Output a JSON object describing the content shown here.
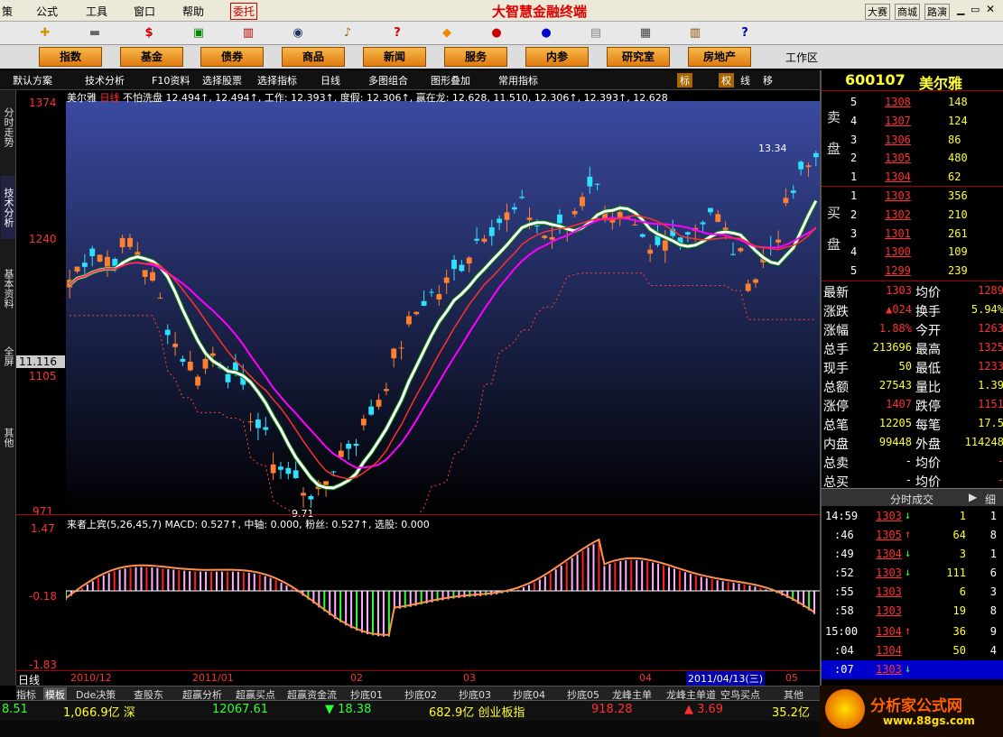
{
  "app": {
    "title": "大智慧金融终端",
    "weituo": "委托",
    "links": [
      "大赛",
      "商城",
      "路演"
    ]
  },
  "menus": [
    "策",
    "公式",
    "工具",
    "窗口",
    "帮助"
  ],
  "tabs": [
    "指数",
    "基金",
    "债券",
    "商品",
    "新闻",
    "服务",
    "内参",
    "研究室",
    "房地产"
  ],
  "workzone": "工作区",
  "subtools": [
    "默认方案",
    "技术分析",
    "F10资料",
    "选择股票",
    "选择指标",
    "日线",
    "多图组合",
    "图形叠加",
    "常用指标"
  ],
  "subtools_right": [
    "标",
    "权",
    "线",
    "移"
  ],
  "sidebar": [
    "分时走势",
    "技术分析",
    "基本资料",
    "全屏",
    "其他"
  ],
  "chart": {
    "legend_left": "美尔雅",
    "legend_period": "日线",
    "legend_text": "不怕洗盘 12.494↑, 12.494↑, 工作: 12.393↑, 度假: 12.306↑, 赢在龙: 12.628, 11.510, 12.306↑, 12.393↑, 12.628",
    "y_labels": [
      "1374",
      "1240",
      "1105",
      "971"
    ],
    "current_price": "11.116",
    "peak_label": "13.34",
    "low_label": "9.71",
    "macd_text": "来者上宾(5,26,45,7) MACD: 0.527↑, 中轴: 0.000, 粉丝: 0.527↑, 选股: 0.000",
    "macd_y": [
      "1.47",
      "-0.18",
      "-1.83"
    ],
    "x_labels": [
      "2010/12",
      "2011/01",
      "02",
      "03",
      "04",
      "2011/04/13(三)",
      "05"
    ],
    "period": "日线"
  },
  "chart_data": {
    "type": "candlestick",
    "title": "美尔雅 日线",
    "ylim": [
      9.71,
      13.74
    ],
    "peak": 13.34,
    "low": 9.71
  },
  "quote": {
    "code": "600107",
    "name": "美尔雅",
    "sell": [
      [
        "5",
        "1308",
        "148"
      ],
      [
        "4",
        "1307",
        "124"
      ],
      [
        "3",
        "1306",
        "86"
      ],
      [
        "2",
        "1305",
        "480"
      ],
      [
        "1",
        "1304",
        "62"
      ]
    ],
    "buy": [
      [
        "1",
        "1303",
        "356"
      ],
      [
        "2",
        "1302",
        "210"
      ],
      [
        "3",
        "1301",
        "261"
      ],
      [
        "4",
        "1300",
        "109"
      ],
      [
        "5",
        "1299",
        "239"
      ]
    ],
    "sell_label": "卖盘",
    "buy_label": "买盘",
    "stats": [
      [
        "最新",
        "1303",
        "均价",
        "1289"
      ],
      [
        "涨跌",
        "▲024",
        "换手",
        "5.94%"
      ],
      [
        "涨幅",
        "1.88%",
        "今开",
        "1263"
      ],
      [
        "总手",
        "213696",
        "最高",
        "1325"
      ],
      [
        "现手",
        "50",
        "最低",
        "1233"
      ],
      [
        "总额",
        "27543",
        "量比",
        "1.39"
      ],
      [
        "涨停",
        "1407",
        "跌停",
        "1151"
      ],
      [
        "总笔",
        "12205",
        "每笔",
        "17.5"
      ],
      [
        "内盘",
        "99448",
        "外盘",
        "114248"
      ],
      [
        "总卖",
        "-",
        "均价",
        "-"
      ],
      [
        "总买",
        "-",
        "均价",
        "-"
      ]
    ],
    "ticks_title": "分时成交",
    "ticks_detail": "细",
    "ticks": [
      [
        "14:59",
        "1303",
        "↓",
        "1",
        "1"
      ],
      [
        ":46",
        "1305",
        "↑",
        "64",
        "8"
      ],
      [
        ":49",
        "1304",
        "↓",
        "3",
        "1"
      ],
      [
        ":52",
        "1303",
        "↓",
        "111",
        "6"
      ],
      [
        ":55",
        "1303",
        "",
        "6",
        "3"
      ],
      [
        ":58",
        "1303",
        "",
        "19",
        "8"
      ],
      [
        "15:00",
        "1304",
        "↑",
        "36",
        "9"
      ],
      [
        ":04",
        "1304",
        "",
        "50",
        "4"
      ],
      [
        ":07",
        "1303",
        "↓",
        "",
        ""
      ]
    ]
  },
  "bottomtabs": [
    "指标",
    "模板",
    "Dde决策",
    "查股东",
    "超赢分析",
    "超赢买点",
    "超赢资金流",
    "抄底01",
    "抄底02",
    "抄底03",
    "抄底04",
    "抄底05",
    "龙峰主单",
    "龙峰主单道",
    "空鸟买点",
    "其他"
  ],
  "status": {
    "s1": "8.51",
    "s2": "1,066.9亿 深",
    "s3": "12067.61",
    "s4": "▼ 18.38",
    "s5": "682.9亿 创业板指",
    "s6": "918.28",
    "s7": "▲ 3.69",
    "s8": "35.2亿"
  },
  "logo": "分析家公式网",
  "logo_url": "www.88gs.com"
}
